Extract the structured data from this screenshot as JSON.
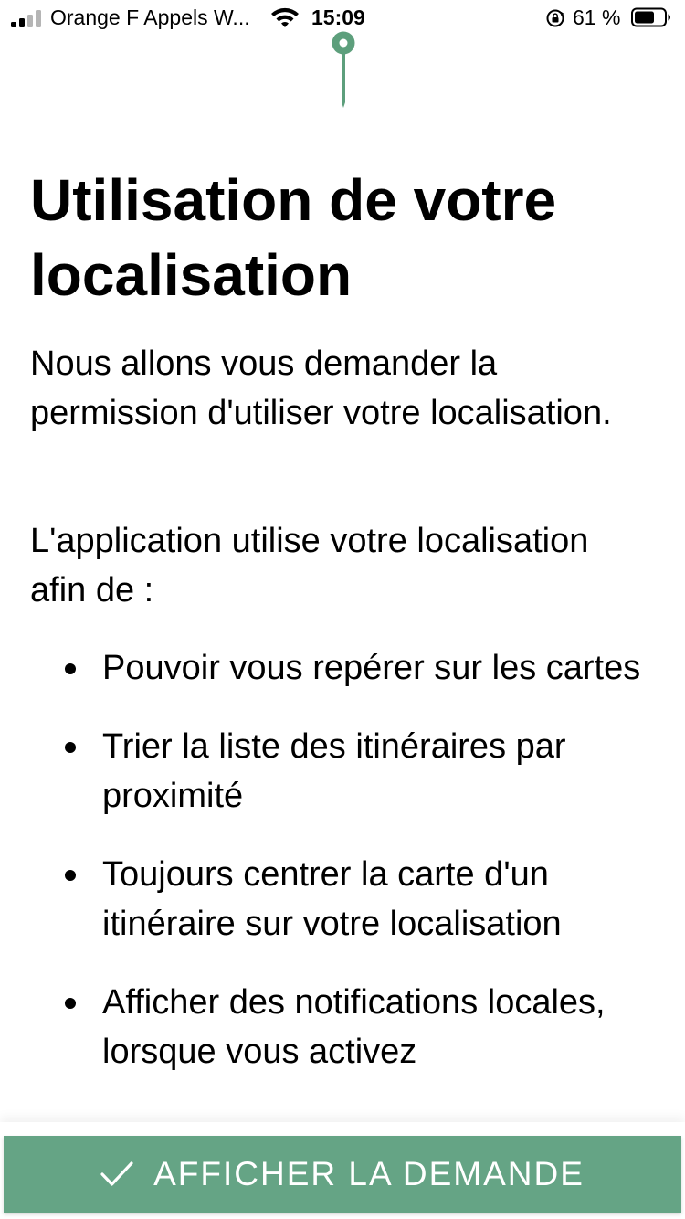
{
  "status_bar": {
    "carrier": "Orange F Appels W...",
    "time": "15:09",
    "battery_percent": "61 %",
    "signal_bars_filled": 2,
    "signal_bars_total": 4,
    "icons": [
      "signal-icon",
      "wifi-icon",
      "rotation-lock-icon",
      "battery-icon"
    ]
  },
  "header_icon": "location-pin-icon",
  "content": {
    "title": "Utilisation de votre localisation",
    "intro": "Nous allons vous demander la permission d'utiliser votre localisation.",
    "lead": "L'application utilise votre localisation afin de :",
    "bullets": [
      {
        "text": "Pouvoir vous repérer sur les cartes"
      },
      {
        "text": "Trier la liste des itinéraires par proximité"
      },
      {
        "text": "Toujours centrer la carte d'un itinéraire sur votre localisation"
      },
      {
        "text": "Afficher des notifications locales, lorsque vous activez"
      }
    ]
  },
  "action": {
    "label": "AFFICHER LA DEMANDE",
    "icon": "checkmark-icon"
  },
  "colors": {
    "accent": "#65a485",
    "pin": "#5d9f7c",
    "text": "#000000",
    "background": "#ffffff"
  }
}
